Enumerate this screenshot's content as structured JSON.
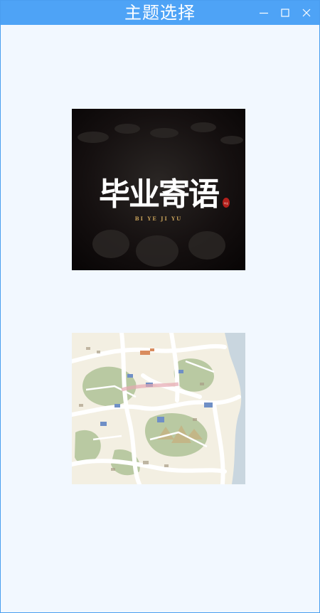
{
  "window": {
    "title": "主题选择",
    "controls": {
      "minimize": "minimize-icon",
      "maximize": "maximize-icon",
      "close": "close-icon"
    },
    "colors": {
      "titlebar": "#4ea3f6",
      "background": "#f2f8ff"
    }
  },
  "themes": [
    {
      "calligraphy": "毕业寄语",
      "romanization": "BI  YE  JI  YU",
      "seal": "毕业"
    },
    {
      "image": "hand-drawn campus map"
    }
  ]
}
